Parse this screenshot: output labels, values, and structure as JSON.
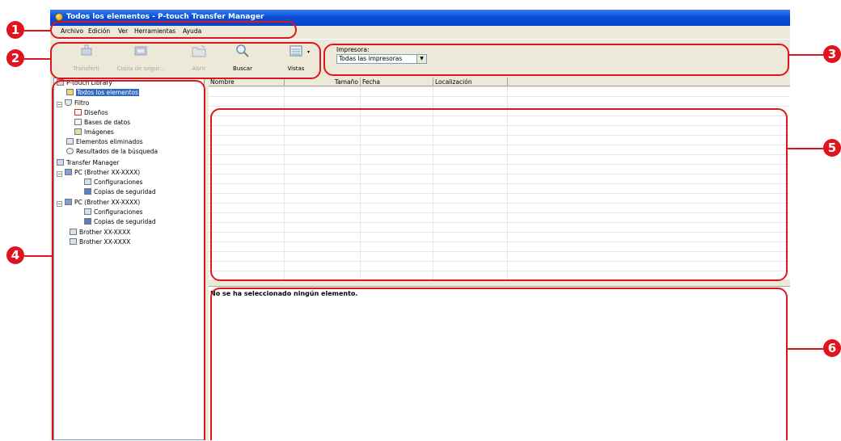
{
  "window": {
    "title": "Todos los elementos - P-touch Transfer Manager"
  },
  "menu": {
    "items": [
      "Archivo",
      "Edición",
      "Ver",
      "Herramientas",
      "Ayuda"
    ]
  },
  "toolbar": {
    "transfer": "Transferir",
    "backup": "Copia de segur...",
    "open": "Abrir",
    "search": "Buscar",
    "views": "Vistas"
  },
  "printer": {
    "label": "Impresora:",
    "selected": "Todas las impresoras"
  },
  "tree": {
    "library": "P-touch Library",
    "all": "Todos los elementos",
    "filter": "Filtro",
    "designs": "Diseños",
    "databases": "Bases de datos",
    "images": "Imágenes",
    "deleted": "Elementos eliminados",
    "results": "Resultados de la búsqueda",
    "transfer_manager": "Transfer Manager",
    "pc1": "PC (Brother XX-XXXX)",
    "pc1_config": "Configuraciones",
    "pc1_backup": "Copias de seguridad",
    "pc2": "PC (Brother XX-XXXX)",
    "pc2_config": "Configuraciones",
    "pc2_backup": "Copias de seguridad",
    "dev1": "Brother XX-XXXX",
    "dev2": "Brother XX-XXXX"
  },
  "list": {
    "columns": [
      "Nombre",
      "Tamaño",
      "Fecha",
      "Localización"
    ]
  },
  "detail": {
    "message": "No se ha seleccionado ningún elemento."
  },
  "callouts": [
    "1",
    "2",
    "3",
    "4",
    "5",
    "6"
  ],
  "colors": {
    "annotation": "#e0141c",
    "titlebar": "#0a4fd6",
    "selection": "#316ac5"
  }
}
